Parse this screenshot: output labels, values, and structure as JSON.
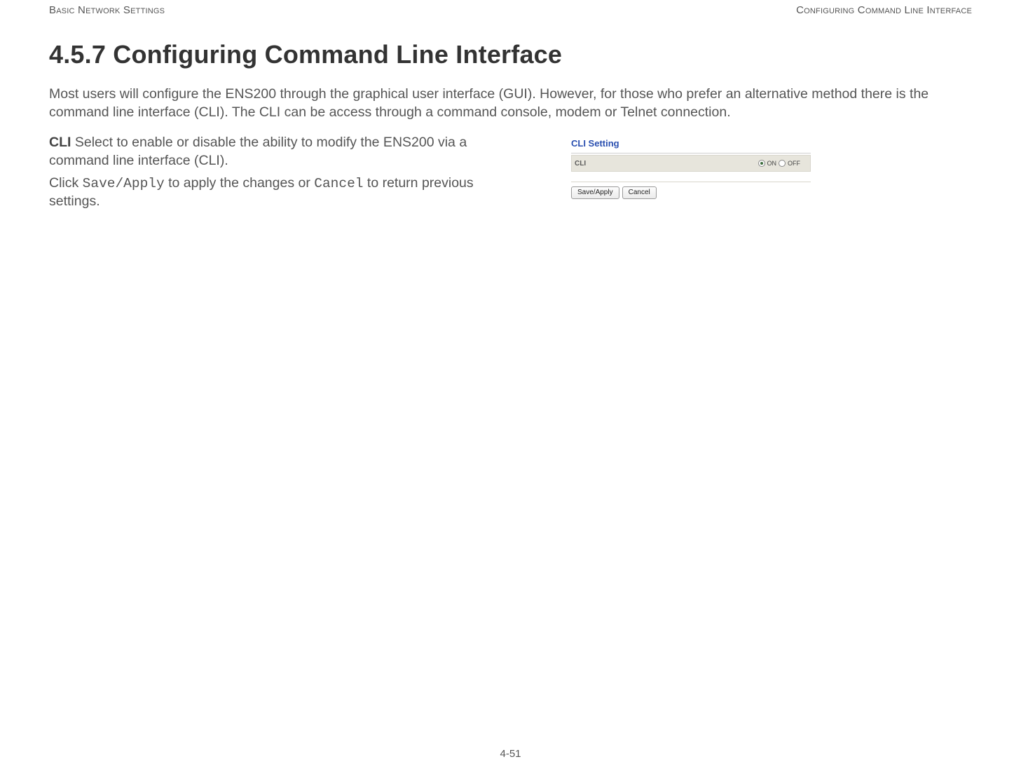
{
  "header": {
    "left": "Basic Network Settings",
    "right": "Configuring Command Line Interface"
  },
  "section": {
    "number": "4.5.7",
    "title": "Configuring Command Line Interface"
  },
  "intro": "Most users will configure the ENS200 through the graphical user interface (GUI). However, for those who prefer an alternative method there is the command line interface (CLI).  The CLI can be access through a command console, modem or Telnet connection.",
  "body": {
    "cli_term": "CLI",
    "cli_desc": "  Select to enable or disable the ability to modify the ENS200 via a command line interface (CLI).",
    "apply_pre": "Click ",
    "save_apply_mono": "Save/Apply",
    "apply_mid": " to apply the changes or ",
    "cancel_mono": "Cancel",
    "apply_post": " to return previous settings."
  },
  "figure": {
    "panel_title": "CLI Setting",
    "row_label": "CLI",
    "on_label": "ON",
    "off_label": "OFF",
    "selected": "on",
    "buttons": {
      "save_apply": "Save/Apply",
      "cancel": "Cancel"
    }
  },
  "footer": {
    "page_number": "4-51"
  }
}
